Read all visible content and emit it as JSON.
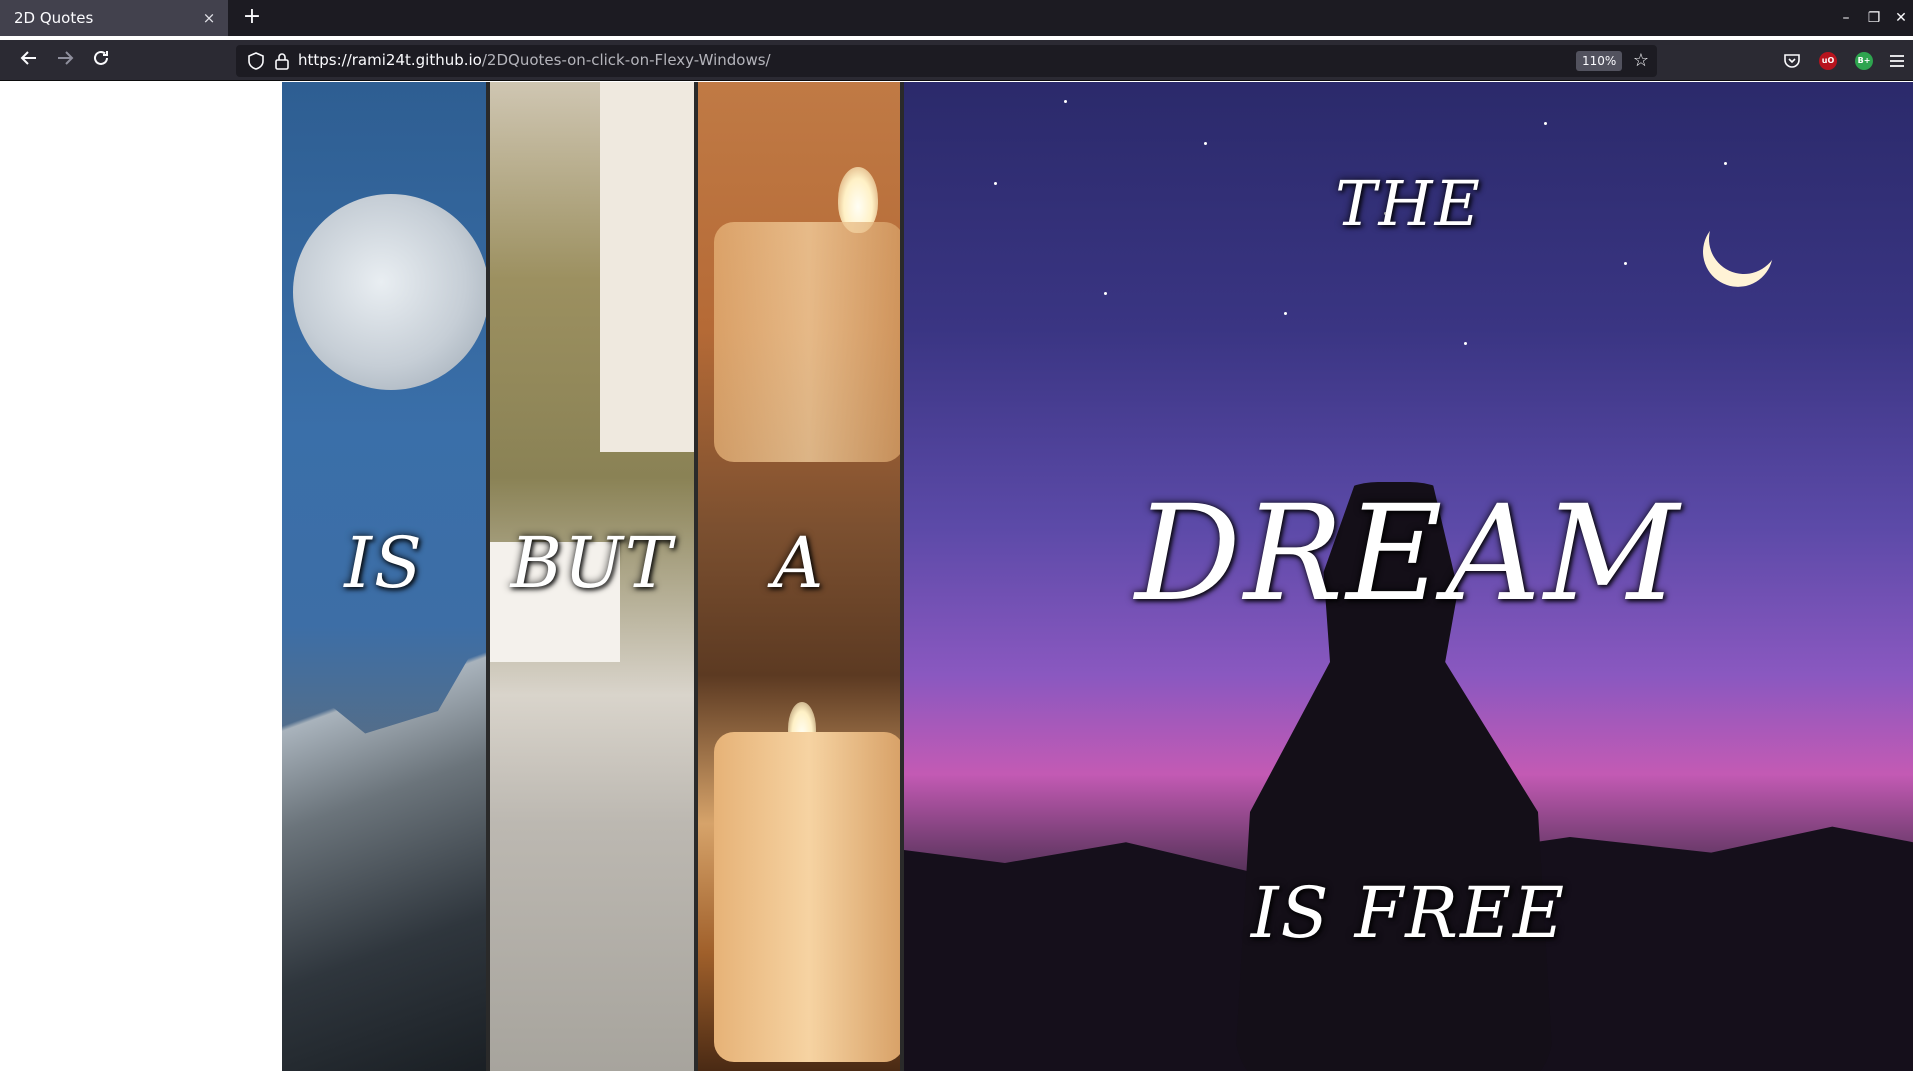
{
  "browser": {
    "tab_title": "2D Quotes",
    "tab_close": "×",
    "new_tab": "+",
    "url_host": "https://rami24t.github.io",
    "url_path": "/2DQuotes-on-click-on-Flexy-Windows/",
    "zoom": "110%",
    "window_controls": [
      "–",
      "❐",
      "✕"
    ],
    "extensions": [
      {
        "label": "uO",
        "color": "#b7141e"
      },
      {
        "label": "B+",
        "color": "#2ea44f"
      }
    ]
  },
  "quote": {
    "panels": [
      {
        "word": "IS",
        "theme": "moon-mountain"
      },
      {
        "word": "BUT",
        "theme": "desk"
      },
      {
        "word": "A",
        "theme": "candles"
      },
      {
        "top": "THE",
        "main": "DREAM",
        "bottom": "IS FREE",
        "theme": "night-sky"
      }
    ]
  }
}
